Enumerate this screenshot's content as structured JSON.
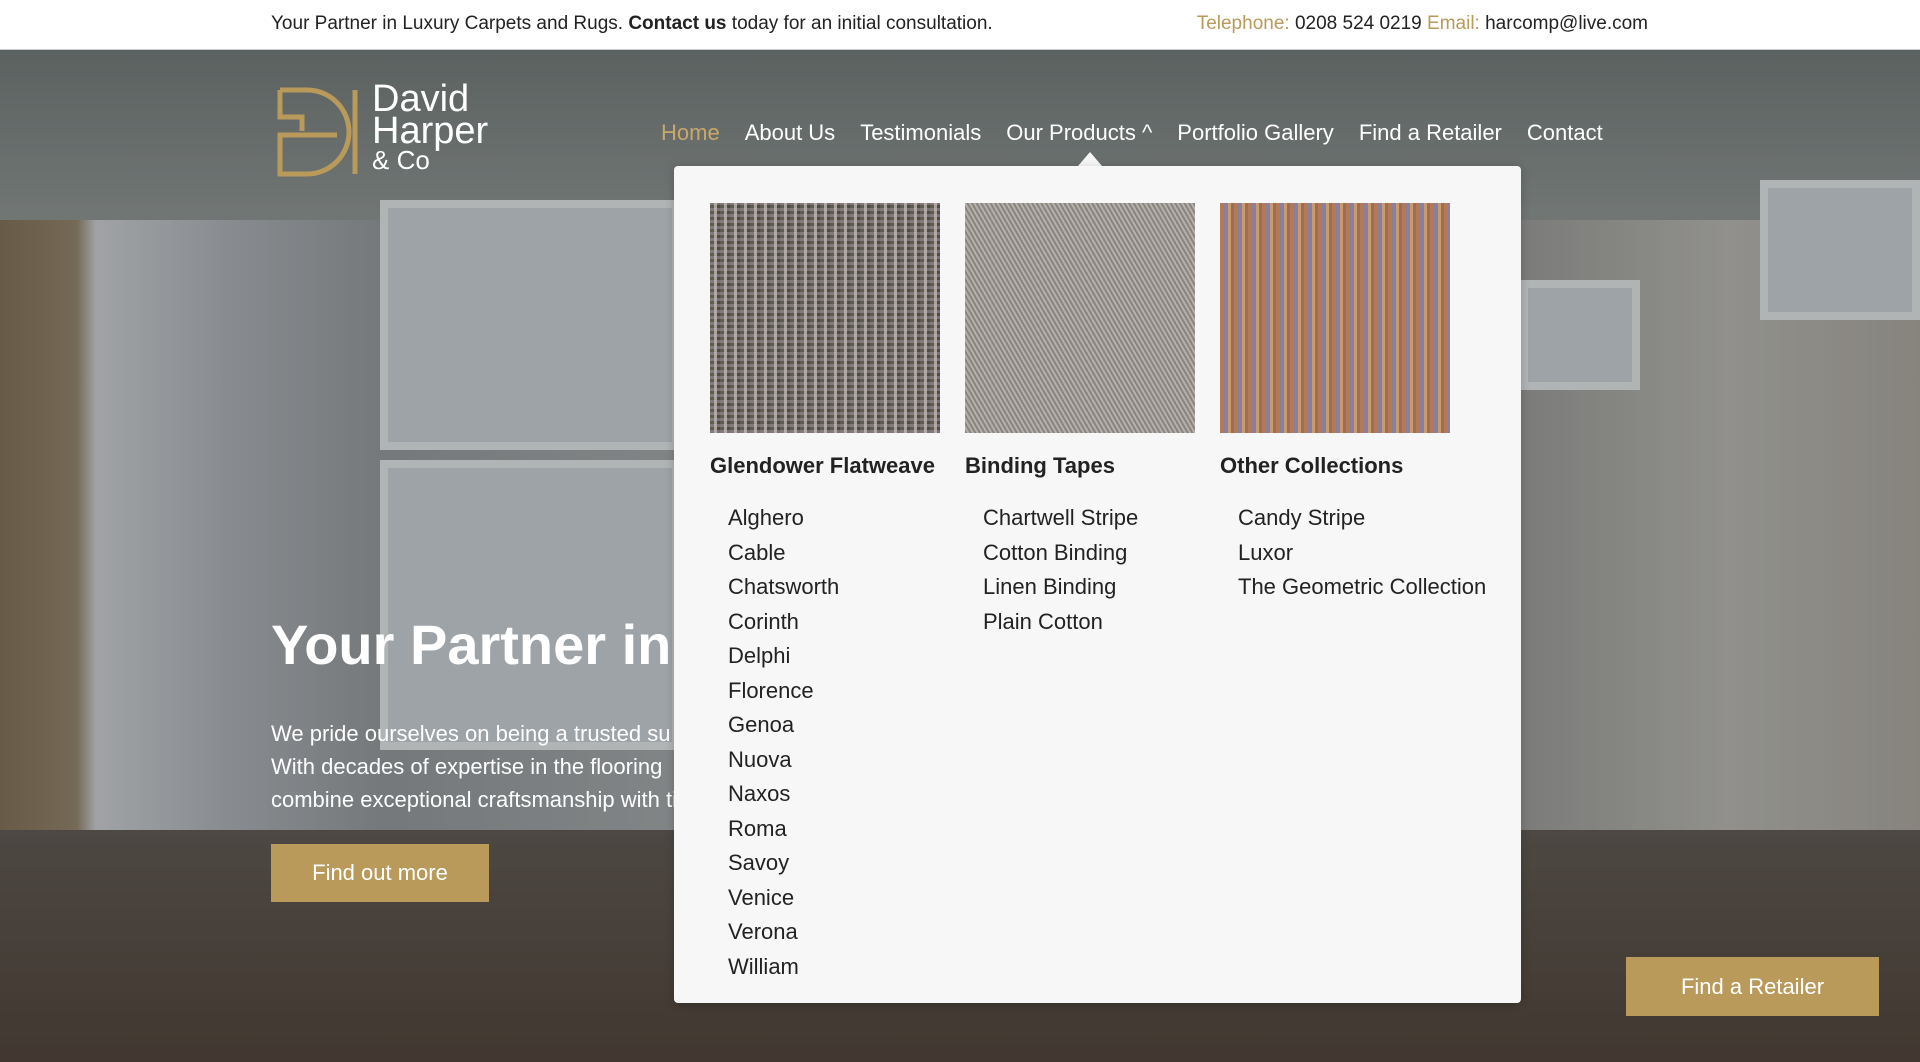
{
  "topbar": {
    "tagline_pre": "Your Partner in Luxury Carpets and Rugs. ",
    "tagline_link": "Contact us",
    "tagline_post": " today for an initial consultation.",
    "phone_label": "Telephone:",
    "phone": " 0208 524 0219 ",
    "email_label": "Email:",
    "email": " harcomp@live.com"
  },
  "logo": {
    "line1": "David",
    "line2": "Harper",
    "line3": "& Co"
  },
  "nav": {
    "items": [
      "Home",
      "About Us",
      "Testimonials",
      "Our Products",
      "Portfolio Gallery",
      "Find a Retailer",
      "Contact"
    ],
    "chevron": "^"
  },
  "menu": {
    "columns": [
      {
        "title": "Glendower Flatweave",
        "items": [
          "Alghero",
          "Cable",
          "Chatsworth",
          "Corinth",
          "Delphi",
          "Florence",
          "Genoa",
          "Nuova",
          "Naxos",
          "Roma",
          "Savoy",
          "Venice",
          "Verona",
          "William"
        ]
      },
      {
        "title": "Binding Tapes",
        "items": [
          "Chartwell Stripe",
          "Cotton Binding",
          "Linen Binding",
          "Plain Cotton"
        ]
      },
      {
        "title": "Other Collections",
        "items": [
          "Candy Stripe",
          "Luxor",
          "The Geometric Collection"
        ]
      }
    ]
  },
  "hero": {
    "title": "Your Partner in",
    "text": [
      "We pride ourselves on being a trusted su",
      "With decades of expertise in the flooring",
      "combine exceptional craftsmanship with ti"
    ],
    "button": "Find out more"
  },
  "retailer_button": "Find a Retailer",
  "colors": {
    "accent": "#b99a5a"
  }
}
